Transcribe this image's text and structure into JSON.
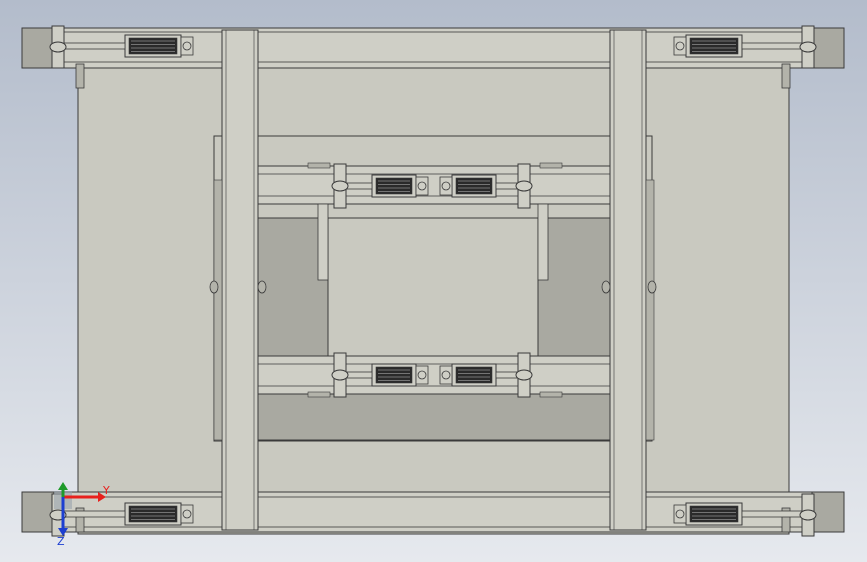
{
  "viewport": {
    "background_top": "#b3bccb",
    "background_bottom": "#e6e9ee"
  },
  "model": {
    "fill_plate": "#c9c9c0",
    "fill_rail": "#cfcfc6",
    "fill_shadow": "#a9a9a1",
    "fill_dark": "#b3b3aa",
    "edge": "#3a3a3a",
    "cylinder": "#2a2a2a"
  },
  "triad": {
    "x_label": "Y",
    "z_label": "Z",
    "x_color": "#e8201c",
    "y_color": "#1e9a2a",
    "z_color": "#1d3fd1"
  }
}
